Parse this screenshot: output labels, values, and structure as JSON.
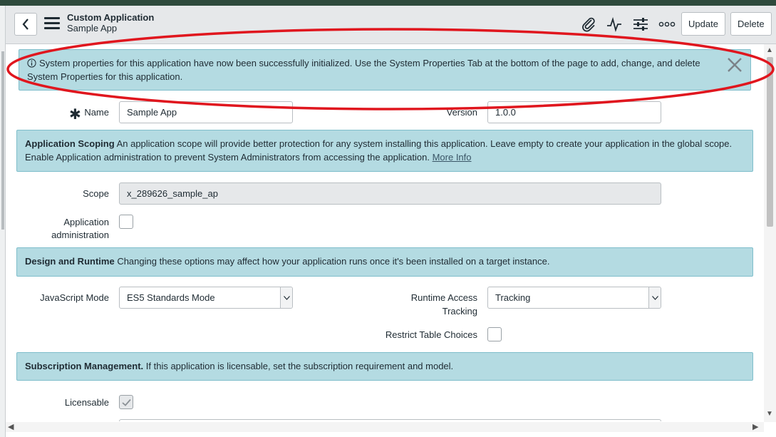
{
  "header": {
    "title": "Custom Application",
    "subtitle": "Sample App",
    "update_label": "Update",
    "delete_label": "Delete"
  },
  "notification": {
    "text": "System properties for this application have now been successfully initialized. Use the System Properties Tab at the bottom of the page to add, change, and delete System Properties for this application."
  },
  "form": {
    "name_label": "Name",
    "name_value": "Sample App",
    "version_label": "Version",
    "version_value": "1.0.0",
    "scoping": {
      "title": "Application Scoping",
      "text": "An application scope will provide better protection for any system installing this application. Leave empty to create your application in the global scope. Enable Application administration to prevent System Administrators from accessing the application.",
      "link": "More Info"
    },
    "scope_label": "Scope",
    "scope_value": "x_289626_sample_ap",
    "app_admin_label_1": "Application",
    "app_admin_label_2": "administration",
    "design": {
      "title": "Design and Runtime",
      "text": "Changing these options may affect how your application runs once it's been installed on a target instance."
    },
    "js_mode_label": "JavaScript Mode",
    "js_mode_value": "ES5 Standards Mode",
    "runtime_label_1": "Runtime Access",
    "runtime_label_2": "Tracking",
    "runtime_value": "Tracking",
    "restrict_label": "Restrict Table Choices",
    "subscription": {
      "title": "Subscription Management.",
      "text": "If this application is licensable, set the subscription requirement and model."
    },
    "licensable_label": "Licensable"
  },
  "colors": {
    "info_background": "#b4dbe2",
    "annotation_ellipse": "#e0161e"
  }
}
